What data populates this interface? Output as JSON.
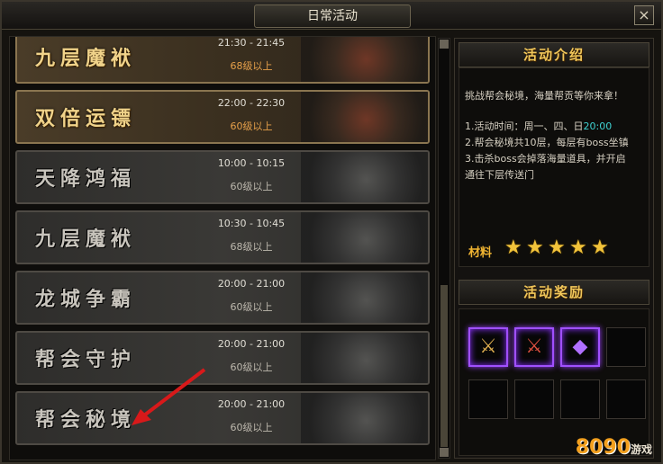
{
  "window": {
    "title": "日常活动",
    "close_icon": "×"
  },
  "activities": [
    {
      "name": "九层魔袱",
      "time": "21:30 - 21:45",
      "level": "68级以上",
      "active": true
    },
    {
      "name": "双倍运镖",
      "time": "22:00 - 22:30",
      "level": "60级以上",
      "active": true
    },
    {
      "name": "天降鸿福",
      "time": "10:00 - 10:15",
      "level": "60级以上",
      "active": false
    },
    {
      "name": "九层魔袱",
      "time": "10:30 - 10:45",
      "level": "68级以上",
      "active": false
    },
    {
      "name": "龙城争霸",
      "time": "20:00 - 21:00",
      "level": "60级以上",
      "active": false
    },
    {
      "name": "帮会守护",
      "time": "20:00 - 21:00",
      "level": "60级以上",
      "active": false
    },
    {
      "name": "帮会秘境",
      "time": "20:00 - 21:00",
      "level": "60级以上",
      "active": false
    }
  ],
  "intro": {
    "heading": "活动介绍",
    "line1": "挑战帮会秘境，海量帮贡等你来拿！",
    "line2_prefix": "1.活动时间：周一、四、日",
    "line2_time": "20:00",
    "line3": "2.帮会秘境共10层，每层有boss坐镇",
    "line4": "3.击杀boss会掉落海量道具，并开启",
    "line5": "通往下层传送门",
    "material_label": "材料",
    "material_stars": 5
  },
  "rewards": {
    "heading": "活动奖励",
    "items": [
      "令牌",
      "令牌",
      "紫晶"
    ]
  },
  "watermark": {
    "brand": "8090",
    "sub": "游戏"
  },
  "colors": {
    "accent_gold": "#f1c75a",
    "item_purple": "#a050ff",
    "time_cyan": "#3fd2d2"
  }
}
